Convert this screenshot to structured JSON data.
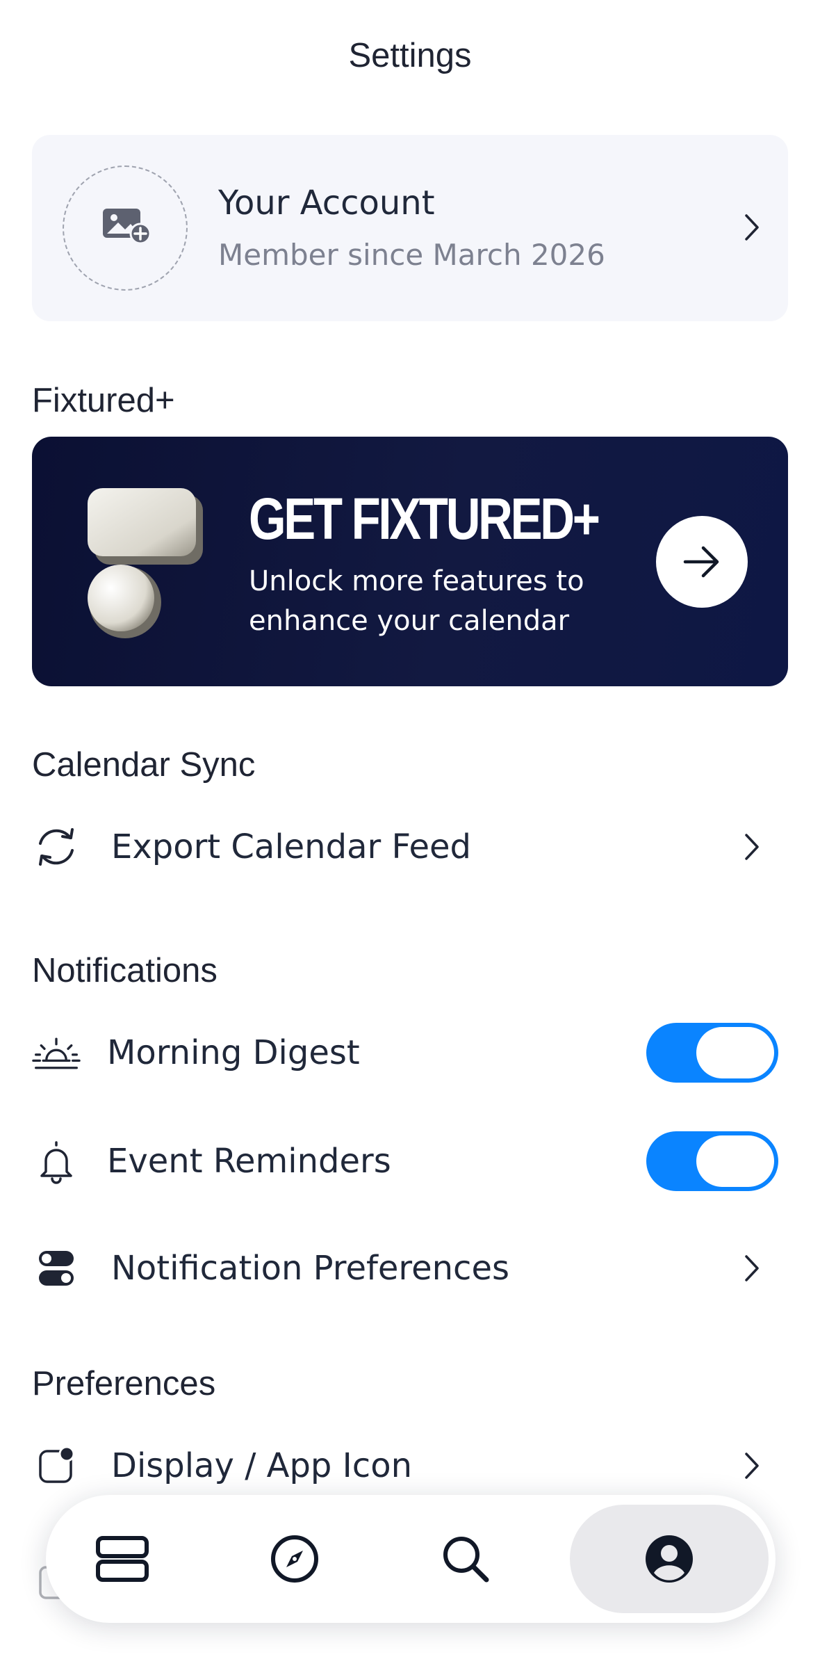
{
  "header": {
    "title": "Settings"
  },
  "account": {
    "name": "Your Account",
    "member_since": "Member since March 2026"
  },
  "sections": {
    "fixtured_plus": "Fixtured+",
    "calendar_sync": "Calendar Sync",
    "notifications": "Notifications",
    "preferences": "Preferences"
  },
  "promo": {
    "title": "GET FIXTURED+",
    "text": "Unlock more features to enhance your calendar"
  },
  "calendar_sync": {
    "export_label": "Export Calendar Feed"
  },
  "notifications": {
    "morning_digest_label": "Morning Digest",
    "morning_digest_on": true,
    "event_reminders_label": "Event Reminders",
    "event_reminders_on": true,
    "preferences_label": "Notification Preferences"
  },
  "preferences": {
    "display_label": "Display / App Icon"
  },
  "tabbar": {
    "tabs": [
      {
        "icon": "stack-icon",
        "active": false
      },
      {
        "icon": "compass-icon",
        "active": false
      },
      {
        "icon": "search-icon",
        "active": false
      },
      {
        "icon": "profile-icon",
        "active": true
      }
    ]
  },
  "colors": {
    "accent": "#0a84ff",
    "promo_bg": "#0e1440",
    "card_bg": "#f5f6fb"
  }
}
